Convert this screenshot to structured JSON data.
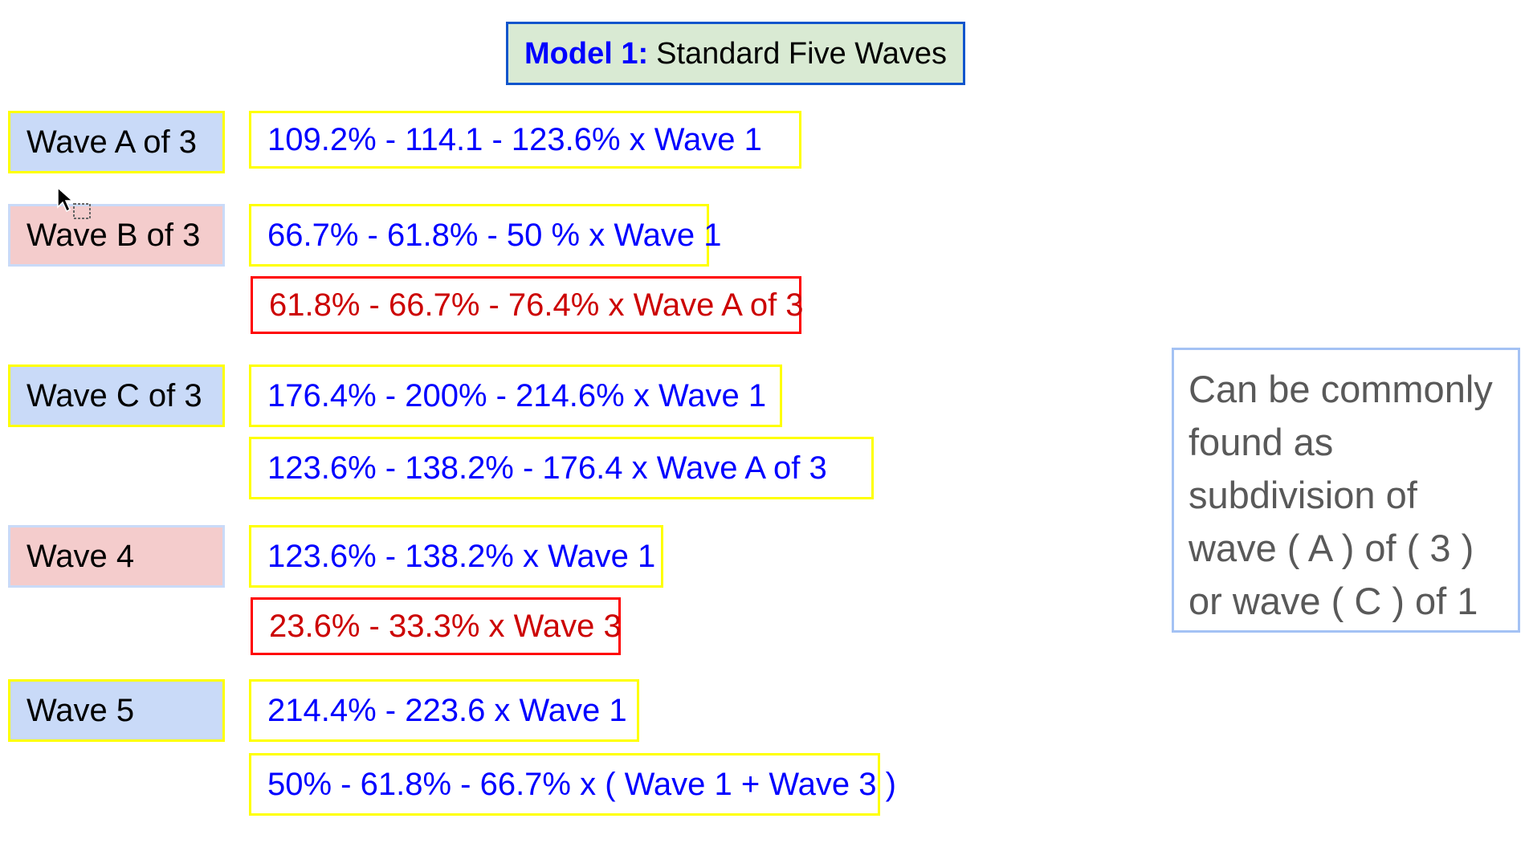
{
  "title": {
    "prefix": "Model 1:",
    "text": "Standard Five Waves"
  },
  "rows": [
    {
      "label": "Wave A of 3",
      "ratios": [
        "109.2% - 114.1 - 123.6% x Wave 1"
      ]
    },
    {
      "label": "Wave B of 3",
      "ratios": [
        "66.7% - 61.8% - 50 % x Wave 1",
        "61.8% - 66.7% - 76.4% x Wave A of 3"
      ]
    },
    {
      "label": "Wave C of 3",
      "ratios": [
        "176.4% - 200% - 214.6% x Wave 1",
        "123.6% - 138.2% - 176.4  x Wave A of 3"
      ]
    },
    {
      "label": "Wave 4",
      "ratios": [
        "123.6% - 138.2% x Wave 1",
        "23.6% - 33.3% x Wave 3"
      ]
    },
    {
      "label": "Wave 5",
      "ratios": [
        "214.4% - 223.6 x Wave 1",
        "50% - 61.8% - 66.7% x ( Wave 1 + Wave 3 )"
      ]
    }
  ],
  "note": "Can be commonly found as subdivision of wave ( A ) of ( 3 ) or wave ( C ) of 1",
  "colors": {
    "label_blue_fill": "#c9daf8",
    "label_pink_fill": "#f4cccc",
    "ratio_text_blue": "#0000ff",
    "ratio_text_red": "#cc0000",
    "highlight_border": "#ffff00",
    "alert_border": "#ff0000",
    "title_fill": "#d9ead3"
  },
  "cursor_icon": "mouse-pointer-icon"
}
